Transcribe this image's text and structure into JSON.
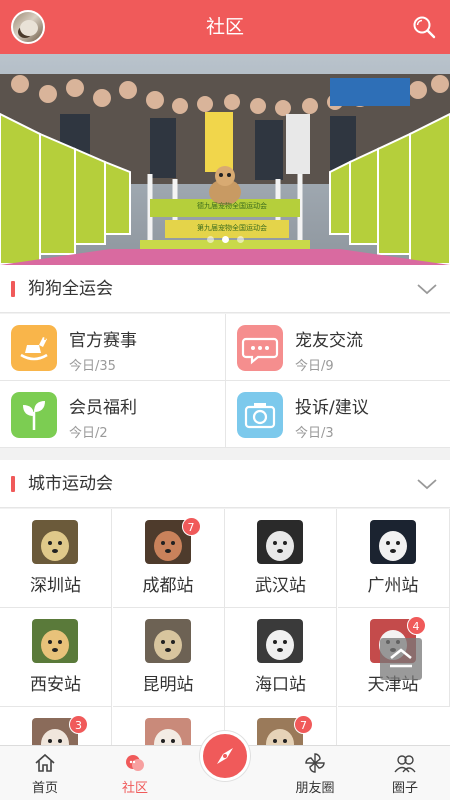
{
  "header": {
    "title": "社区"
  },
  "banner": {
    "slide_count": 3,
    "active_slide": 1,
    "signs": [
      "德九届宠物全国运动会",
      "第九届宠物全国运动会"
    ]
  },
  "sections": {
    "games": {
      "label": "狗狗全运会"
    },
    "cities": {
      "label": "城市运动会"
    }
  },
  "categories": [
    {
      "title": "官方赛事",
      "sub": "今日/35",
      "icon": "rocking-horse-icon",
      "color": "#f9b54a"
    },
    {
      "title": "宠友交流",
      "sub": "今日/9",
      "icon": "chat-bubble-icon",
      "color": "#f58e8e"
    },
    {
      "title": "会员福利",
      "sub": "今日/2",
      "icon": "sprout-icon",
      "color": "#7ccd52"
    },
    {
      "title": "投诉/建议",
      "sub": "今日/3",
      "icon": "camera-icon",
      "color": "#7cc9ec"
    }
  ],
  "cities": [
    {
      "name": "深圳站",
      "badge": ""
    },
    {
      "name": "成都站",
      "badge": "7"
    },
    {
      "name": "武汉站",
      "badge": ""
    },
    {
      "name": "广州站",
      "badge": ""
    },
    {
      "name": "西安站",
      "badge": ""
    },
    {
      "name": "昆明站",
      "badge": ""
    },
    {
      "name": "海口站",
      "badge": ""
    },
    {
      "name": "天津站",
      "badge": "4"
    },
    {
      "name": "",
      "badge": "3"
    },
    {
      "name": "",
      "badge": ""
    },
    {
      "name": "",
      "badge": "7"
    }
  ],
  "nav": {
    "home": "首页",
    "community": "社区",
    "friends": "朋友圈",
    "circle": "圈子"
  },
  "colors": {
    "accent": "#f05a5a"
  }
}
